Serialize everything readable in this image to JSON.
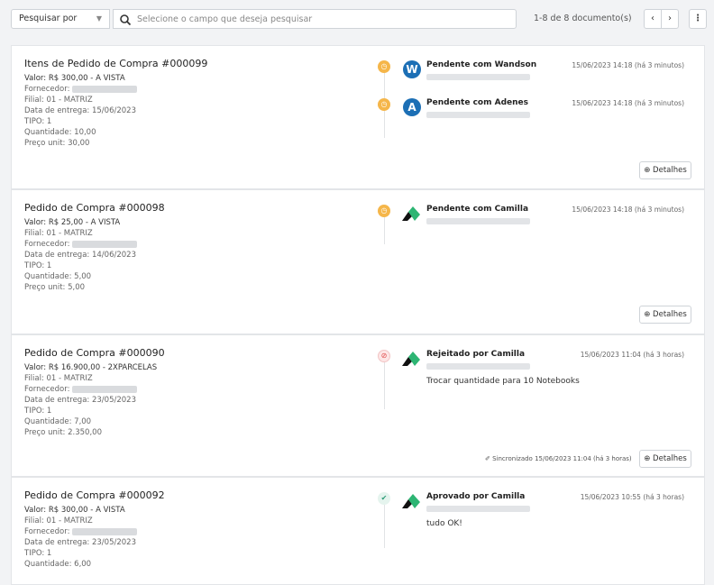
{
  "toolbar": {
    "search_by_label": "Pesquisar por",
    "search_placeholder": "Selecione o campo que deseja pesquisar",
    "pager_text": "1-8 de 8 documento(s)",
    "prev_label": "‹",
    "next_label": "›",
    "menu_label": "⋮"
  },
  "details_label": "Detalhes",
  "cards": [
    {
      "title": "Itens de Pedido de Compra #000099",
      "valor": "Valor: R$ 300,00 - A VISTA",
      "fornecedor_label": "Fornecedor:",
      "filial": "Filial: 01 - MATRIZ",
      "entrega": "Data de entrega: 15/06/2023",
      "tipo": "TIPO: 1",
      "quantidade": "Quantidade: 10,00",
      "preco": "Preço unit: 30,00",
      "approvals": [
        {
          "status": "pending",
          "who": "Pendente  com  Wandson",
          "avatar": "W",
          "time": "15/06/2023 14:18 (há 3 minutos)"
        },
        {
          "status": "pending",
          "who": "Pendente  com  Adenes",
          "avatar": "A",
          "time": "15/06/2023 14:18 (há 3 minutos)"
        }
      ]
    },
    {
      "title": "Pedido de Compra #000098",
      "valor": "Valor: R$ 25,00 - A VISTA",
      "filial": "Filial: 01 - MATRIZ",
      "fornecedor_label": "Fornecedor:",
      "entrega": "Data de entrega: 14/06/2023",
      "tipo": "TIPO: 1",
      "quantidade": "Quantidade: 5,00",
      "preco": "Preço unit: 5,00",
      "approvals": [
        {
          "status": "pending",
          "who": "Pendente  com  Camilla",
          "time": "15/06/2023 14:18 (há 3 minutos)"
        }
      ]
    },
    {
      "title": "Pedido de Compra #000090",
      "valor": "Valor: R$ 16.900,00 - 2XPARCELAS",
      "filial": "Filial: 01 - MATRIZ",
      "fornecedor_label": "Fornecedor:",
      "entrega": "Data de entrega: 23/05/2023",
      "tipo": "TIPO: 1",
      "quantidade": "Quantidade: 7,00",
      "preco": "Preço unit: 2.350,00",
      "sync_text": "✐ Sincronizado 15/06/2023 11:04 (há 3 horas)",
      "approvals": [
        {
          "status": "rejected",
          "who": "Rejeitado  por  Camilla",
          "time": "15/06/2023 11:04 (há 3 horas)",
          "comment": "Trocar quantidade para 10 Notebooks"
        }
      ]
    },
    {
      "title": "Pedido de Compra #000092",
      "valor": "Valor: R$ 300,00 - A VISTA",
      "filial": "Filial: 01 - MATRIZ",
      "fornecedor_label": "Fornecedor:",
      "entrega": "Data de entrega: 23/05/2023",
      "tipo": "TIPO: 1",
      "quantidade": "Quantidade: 6,00",
      "approvals": [
        {
          "status": "approved",
          "who": "Aprovado  por  Camilla",
          "time": "15/06/2023 10:55 (há 3 horas)",
          "comment": "tudo OK!"
        }
      ]
    }
  ],
  "colors": {
    "pending": "#f5b64a",
    "rejected": "#e04b4b",
    "approved": "#2c9c77",
    "avatar_blue": "#1c6fb5",
    "logo_green": "#2db573"
  }
}
